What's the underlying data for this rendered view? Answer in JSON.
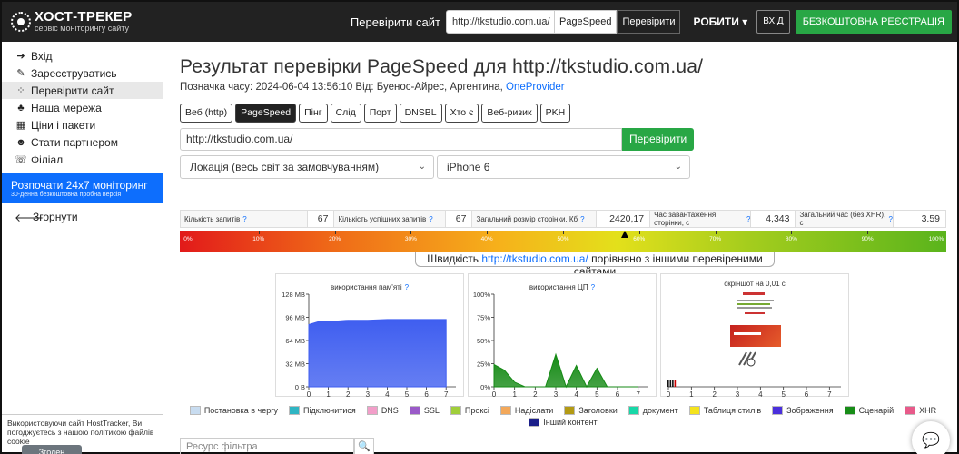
{
  "nav": {
    "logo_title": "ХОСТ-ТРЕКЕР",
    "logo_subtitle": "сервіс моніторингу сайту",
    "check_label": "Перевірити сайт",
    "url_value": "http://tkstudio.com.ua/",
    "pagespeed_label": "PageSpeed",
    "check_button": "Перевірити",
    "menu_label": "РОБИТИ",
    "login_label": "ВХІД",
    "register_label": "БЕЗКОШТОВНА РЕЄСТРАЦІЯ"
  },
  "sidebar": {
    "items": [
      {
        "label": "Вхід",
        "icon": "login-icon"
      },
      {
        "label": "Зареєструватись",
        "icon": "edit-icon"
      },
      {
        "label": "Перевірити сайт",
        "icon": "spinner-icon"
      },
      {
        "label": "Наша мережа",
        "icon": "network-icon"
      },
      {
        "label": "Ціни і пакети",
        "icon": "grid-icon"
      },
      {
        "label": "Стати партнером",
        "icon": "users-icon"
      },
      {
        "label": "Філіал",
        "icon": "handshake-icon"
      }
    ],
    "promo_title": "Розпочати 24x7 моніторинг",
    "promo_subtitle": "30-денна безкоштовна пробна версія",
    "collapse_label": "Згорнути"
  },
  "cookie": {
    "text": "Використовуючи сайт HostTracker, Ви погоджуєтесь з нашою політикою файлів cookie",
    "button": "Згоден"
  },
  "main": {
    "title": "Результат перевірки PageSpeed для http://tkstudio.com.ua/",
    "timestamp_prefix": "Позначка часу: 2024-06-04 13:56:10  Від: Буенос-Айрес, Аргентина,",
    "provider": "OneProvider",
    "tabs": [
      "Веб (http)",
      "PageSpeed",
      "Пінг",
      "Слід",
      "Порт",
      "DNSBL",
      "Хто є",
      "Веб-ризик",
      "PKH"
    ],
    "active_tab": 1,
    "url_value": "http://tkstudio.com.ua/",
    "check_button": "Перевірити",
    "location_select": "Локація (весь світ за замовчуванням)",
    "device_select": "iPhone 6"
  },
  "stats": [
    {
      "label": "Кількість запитів",
      "value": "67"
    },
    {
      "label": "Кількість успішних запитів",
      "value": "67"
    },
    {
      "label": "Загальний розмір сторінки, Кб",
      "value": "2420,17"
    },
    {
      "label": "Час завантаження сторінки, с",
      "value": "4,343"
    },
    {
      "label": "Загальний час (без XHR), с",
      "value": "3.59"
    }
  ],
  "gauge": {
    "ticks": [
      "0%",
      "10%",
      "20%",
      "30%",
      "40%",
      "50%",
      "60%",
      "70%",
      "80%",
      "90%",
      "100%"
    ],
    "marker_percent": 58
  },
  "compare": {
    "prefix": "Швидкість",
    "url": "http://tkstudio.com.ua/",
    "suffix": "порівняно з іншими перевіреними сайтами"
  },
  "panels": {
    "memory_title": "використання пам'яті",
    "cpu_title": "використання ЦП",
    "screenshot_title": "скріншот на 0,01 с"
  },
  "chart_data": [
    {
      "type": "area",
      "title": "використання пам'яті",
      "x": [
        0,
        0.5,
        1,
        1.5,
        2,
        3,
        4,
        5,
        6,
        7
      ],
      "values": [
        86,
        90,
        91,
        91,
        92,
        92,
        93,
        93,
        93,
        93
      ],
      "yticks": [
        "0 B",
        "32 MB",
        "64 MB",
        "96 MB",
        "128 MB"
      ],
      "ylim": [
        0,
        128
      ],
      "xlim": [
        0,
        7.5
      ],
      "color": "#3f5ef0"
    },
    {
      "type": "area",
      "title": "використання ЦП",
      "x": [
        0,
        0.5,
        1,
        1.5,
        2,
        2.5,
        3,
        3.5,
        4,
        4.5,
        5,
        5.5,
        6,
        6.5,
        7
      ],
      "values": [
        24,
        18,
        5,
        0,
        0,
        0,
        35,
        0,
        23,
        0,
        20,
        0,
        0,
        0,
        0
      ],
      "yticks": [
        "0%",
        "25%",
        "50%",
        "75%",
        "100%"
      ],
      "ylim": [
        0,
        100
      ],
      "xlim": [
        0,
        7.5
      ],
      "color": "#158a15"
    },
    {
      "type": "bar",
      "title": "скріншот на 0,01 с",
      "x": [
        0,
        0.1,
        0.2,
        0.3
      ],
      "values": [
        1,
        1,
        1,
        1
      ],
      "xticks": [
        "0",
        "1",
        "2",
        "3",
        "4",
        "5",
        "6"
      ],
      "xlim": [
        0,
        7.5
      ]
    }
  ],
  "legend": [
    {
      "label": "Постановка в чергу",
      "color": "#c8dcf0"
    },
    {
      "label": "Підключитися",
      "color": "#2fb5c3"
    },
    {
      "label": "DNS",
      "color": "#f29ec9"
    },
    {
      "label": "SSL",
      "color": "#9a5ac8"
    },
    {
      "label": "Проксі",
      "color": "#a0ce3a"
    },
    {
      "label": "Надіслати",
      "color": "#f3a85a"
    },
    {
      "label": "Заголовки",
      "color": "#b39a14"
    },
    {
      "label": "документ",
      "color": "#17d8a8"
    },
    {
      "label": "Таблиця стилів",
      "color": "#f4e31d"
    },
    {
      "label": "Зображення",
      "color": "#4a2fdc"
    },
    {
      "label": "Сценарій",
      "color": "#178d17"
    },
    {
      "label": "XHR",
      "color": "#e85a8a"
    },
    {
      "label": "Інший контент",
      "color": "#1b1f8a"
    }
  ],
  "filter": {
    "placeholder": "Ресурс фільтра"
  }
}
